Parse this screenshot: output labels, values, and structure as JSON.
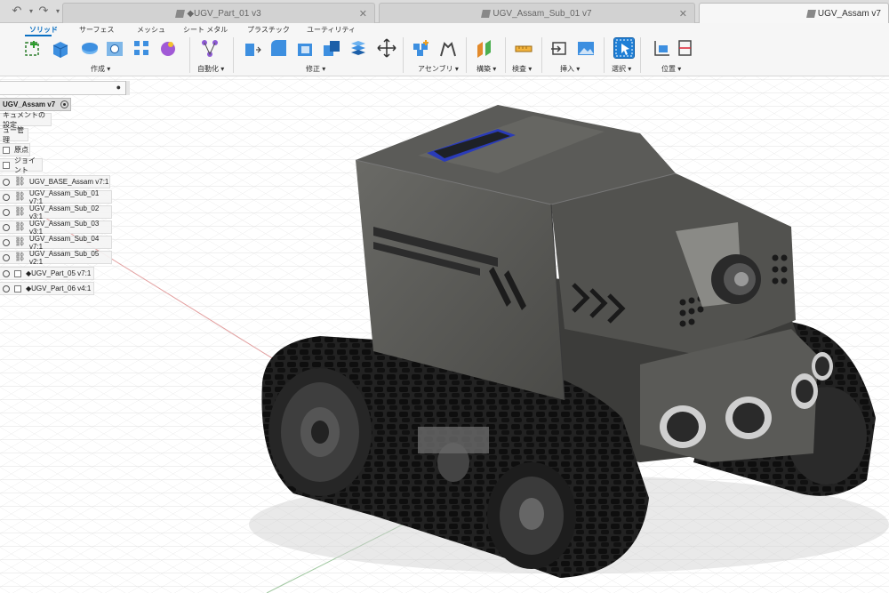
{
  "tabbar": {
    "tabs": [
      {
        "label": "◆UGV_Part_01 v3",
        "active": false
      },
      {
        "label": "UGV_Assam_Sub_01 v7",
        "active": false
      },
      {
        "label": "UGV_Assam v7",
        "active": true
      }
    ]
  },
  "ribbon": {
    "tabs": [
      {
        "label": "ソリッド",
        "active": true
      },
      {
        "label": "サーフェス"
      },
      {
        "label": "メッシュ"
      },
      {
        "label": "シート メタル"
      },
      {
        "label": "プラスチック"
      },
      {
        "label": "ユーティリティ"
      }
    ],
    "groups": [
      {
        "label": "作成 ▾"
      },
      {
        "label": "自動化 ▾"
      },
      {
        "label": "修正 ▾"
      },
      {
        "label": "アセンブリ ▾"
      },
      {
        "label": "構築 ▾"
      },
      {
        "label": "検査 ▾"
      },
      {
        "label": "挿入 ▾"
      },
      {
        "label": "選択 ▾"
      },
      {
        "label": "位置 ▾"
      }
    ]
  },
  "browser": {
    "root": "UGV_Assam v7",
    "items": [
      {
        "label": "キュメントの設定",
        "kind": "folder"
      },
      {
        "label": "ュー管理",
        "kind": "folder"
      },
      {
        "label": "原点",
        "kind": "folder"
      },
      {
        "label": "ジョイント",
        "kind": "folder"
      },
      {
        "label": "UGV_BASE_Assam v7:1",
        "kind": "link"
      },
      {
        "label": "UGV_Assam_Sub_01 v7:1",
        "kind": "link"
      },
      {
        "label": "UGV_Assam_Sub_02 v3:1",
        "kind": "link"
      },
      {
        "label": "UGV_Assam_Sub_03 v3:1",
        "kind": "link"
      },
      {
        "label": "UGV_Assam_Sub_04 v7:1",
        "kind": "link"
      },
      {
        "label": "UGV_Assam_Sub_05 v2:1",
        "kind": "link"
      },
      {
        "label": "◆UGV_Part_05 v7:1",
        "kind": "box"
      },
      {
        "label": "◆UGV_Part_06 v4:1",
        "kind": "box"
      }
    ]
  },
  "colors": {
    "accent": "#0a6fc2",
    "body": "#5c5c5c",
    "track": "#1a1a1a"
  }
}
